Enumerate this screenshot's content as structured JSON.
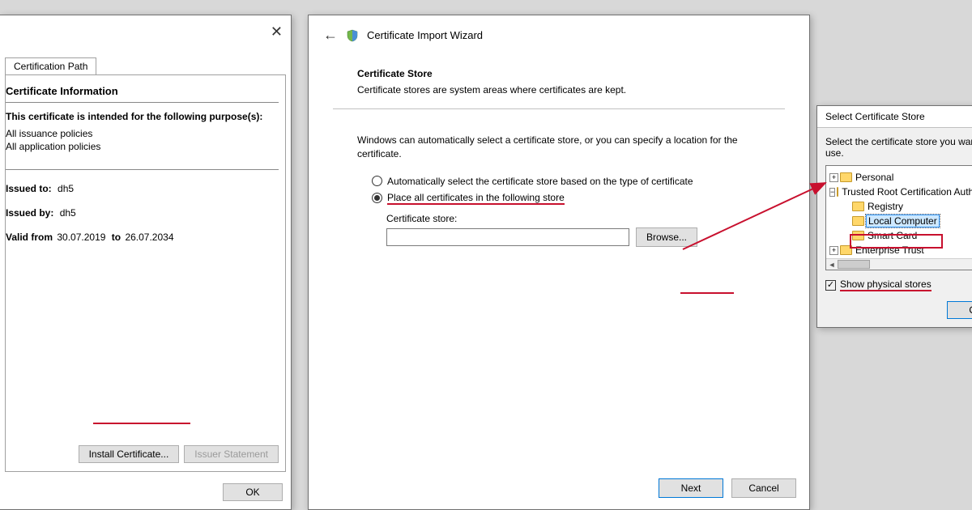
{
  "cert_info": {
    "tab_label": "Certification Path",
    "heading": "Certificate Information",
    "purpose_heading": "This certificate is intended for the following purpose(s):",
    "purposes": [
      "All issuance policies",
      "All application policies"
    ],
    "issued_to_label": "Issued to:",
    "issued_to_value": "dh5",
    "issued_by_label": "Issued by:",
    "issued_by_value": "dh5",
    "valid_from_label": "Valid from",
    "valid_from_value": "30.07.2019",
    "valid_to_label": "to",
    "valid_to_value": "26.07.2034",
    "install_btn": "Install Certificate...",
    "issuer_btn": "Issuer Statement",
    "ok_btn": "OK"
  },
  "wizard": {
    "title": "Certificate Import Wizard",
    "section_heading": "Certificate Store",
    "section_desc": "Certificate stores are system areas where certificates are kept.",
    "hint": "Windows can automatically select a certificate store, or you can specify a location for the certificate.",
    "radio_auto": "Automatically select the certificate store based on the type of certificate",
    "radio_place": "Place all certificates in the following store",
    "store_label": "Certificate store:",
    "browse_btn": "Browse...",
    "next_btn": "Next",
    "cancel_btn": "Cancel"
  },
  "select_store": {
    "title": "Select Certificate Store",
    "instruction": "Select the certificate store you want to use.",
    "tree": {
      "personal": "Personal",
      "trusted_root": "Trusted Root Certification Authorities",
      "registry": "Registry",
      "local_computer": "Local Computer",
      "smart_card": "Smart Card",
      "enterprise_trust": "Enterprise Trust"
    },
    "show_physical": "Show physical stores",
    "ok_btn": "OK"
  }
}
